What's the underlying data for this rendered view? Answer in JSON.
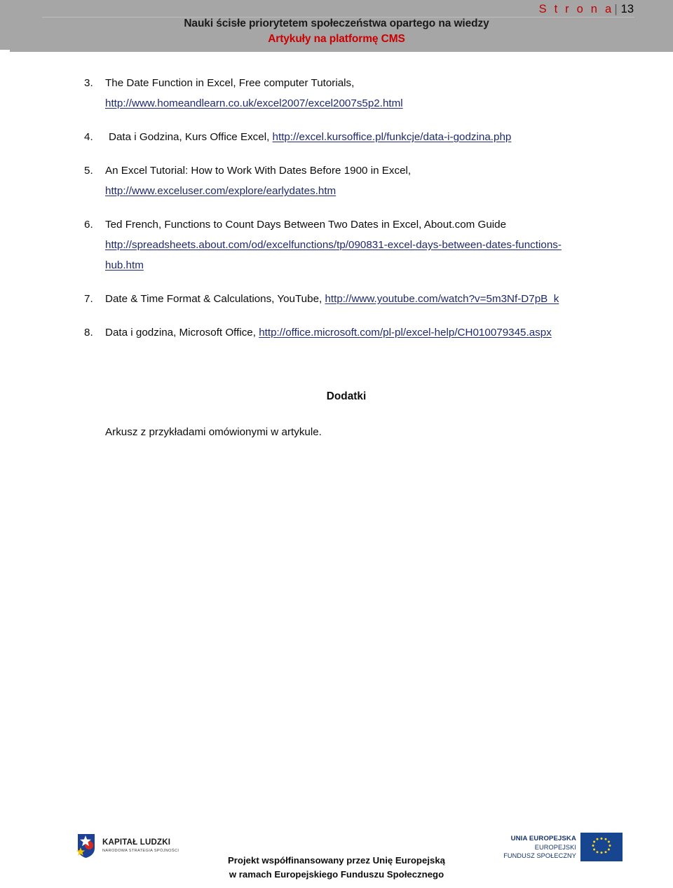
{
  "header": {
    "page_label": "S t r o n a",
    "page_separator": "|",
    "page_number": "13",
    "title_line1": "Nauki ścisłe priorytetem społeczeństwa opartego na wiedzy",
    "title_line2": "Artykuły na platformę CMS",
    "label_color": "#c00000",
    "title2_color": "#cc0000",
    "band_color": "#a6a6a6"
  },
  "references": [
    {
      "number": "3.",
      "text_before": "The Date Function in Excel, Free computer Tutorials, ",
      "link": "http://www.homeandlearn.co.uk/excel2007/excel2007s5p2.html",
      "text_after": ""
    },
    {
      "number": "4.",
      "text_before": " Data i Godzina, Kurs Office Excel, ",
      "link": "http://excel.kursoffice.pl/funkcje/data-i-godzina.php",
      "text_after": ""
    },
    {
      "number": "5.",
      "text_before": "An Excel Tutorial: How to Work With Dates Before 1900 in Excel, ",
      "link": "http://www.exceluser.com/explore/earlydates.htm",
      "text_after": ""
    },
    {
      "number": "6.",
      "text_before": "Ted French, Functions to Count Days Between Two Dates in Excel, About.com Guide ",
      "link": "http://spreadsheets.about.com/od/excelfunctions/tp/090831-excel-days-between-dates-functions-hub.htm",
      "text_after": ""
    },
    {
      "number": "7.",
      "text_before": "Date & Time Format & Calculations, YouTube, ",
      "link": "http://www.youtube.com/watch?v=5m3Nf-D7pB_k",
      "text_after": ""
    },
    {
      "number": "8.",
      "text_before": "Data i godzina, Microsoft Office, ",
      "link": "http://office.microsoft.com/pl-pl/excel-help/CH010079345.aspx",
      "text_after": ""
    }
  ],
  "link_color": "#1f2a6e",
  "dodatki": {
    "heading": "Dodatki",
    "body": "Arkusz z przykładami omówionymi w artykule."
  },
  "footer": {
    "logo_kl": {
      "title": "KAPITAŁ LUDZKI",
      "subtitle": "NARODOWA STRATEGIA SPÓJNOŚCI"
    },
    "center_line1": "Projekt współfinansowany przez Unię Europejską",
    "center_line2": "w ramach Europejskiego Funduszu Społecznego",
    "logo_eu": {
      "line1": "UNIA EUROPEJSKA",
      "line2": "EUROPEJSKI",
      "line3": "FUNDUSZ SPOŁECZNY",
      "flag_color": "#17458f",
      "star_color": "#ffd617"
    }
  }
}
